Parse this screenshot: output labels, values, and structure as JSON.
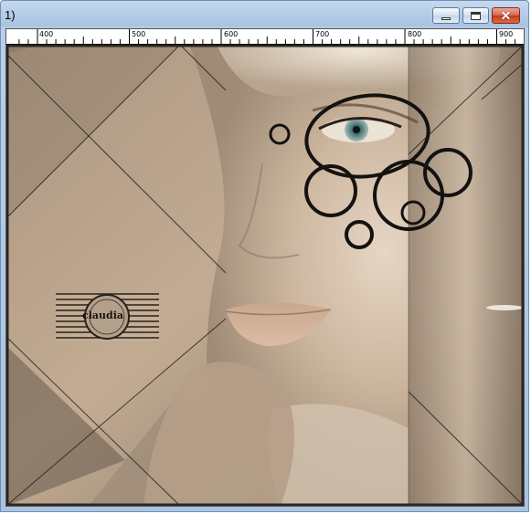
{
  "window": {
    "title": "1)",
    "controls": {
      "minimize_icon": "minimize-icon",
      "maximize_icon": "maximize-icon",
      "close_icon": "close-icon",
      "close_glyph": "✕"
    }
  },
  "ruler": {
    "labels": [
      "400",
      "500",
      "600",
      "700",
      "800",
      "900"
    ]
  },
  "artwork": {
    "watermark_text": "claudia",
    "colors": {
      "background_tone": "#b49e86",
      "skin_tone": "#d6c2ad",
      "dark_frame": "#2a2622",
      "ring_color": "#141210"
    }
  }
}
